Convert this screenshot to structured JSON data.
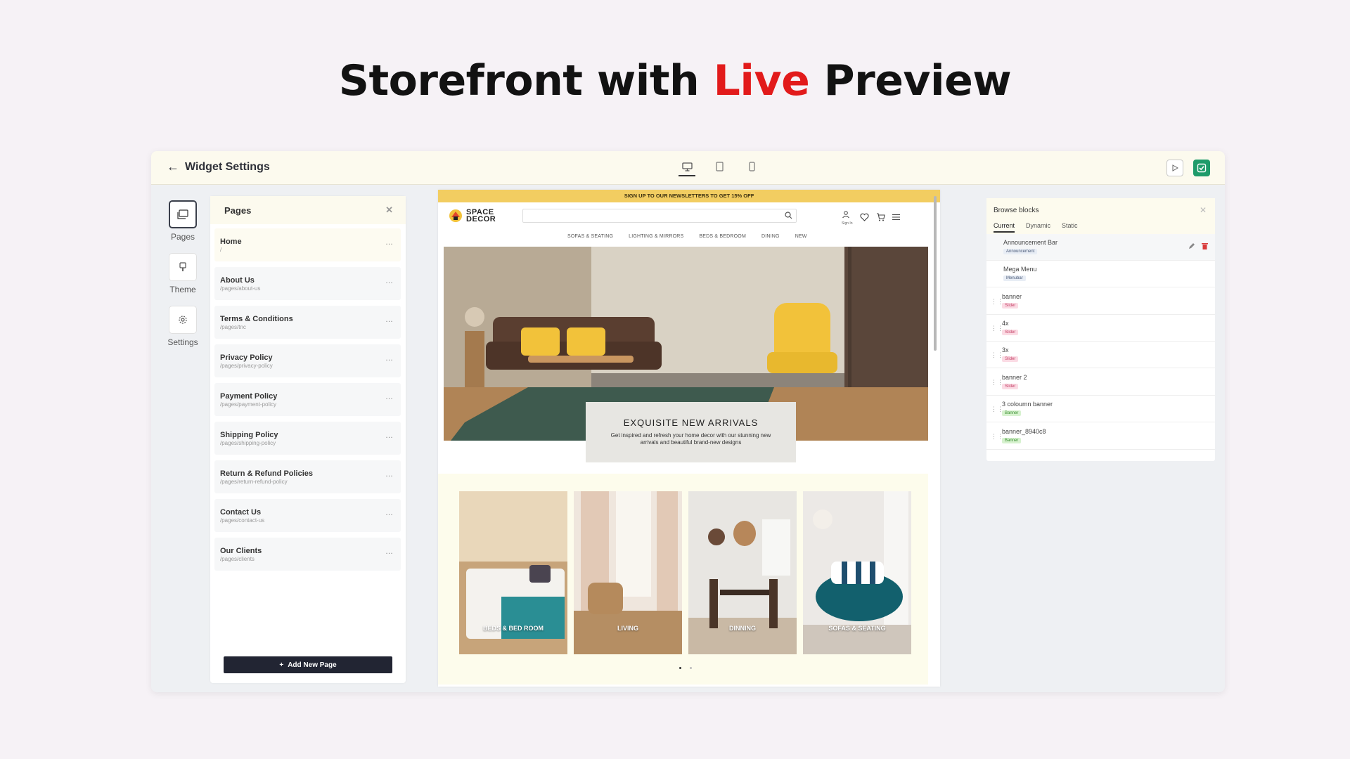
{
  "headline": {
    "part1": "Storefront with ",
    "accent": "Live",
    "part2": " Preview",
    "accent_color": "#e21b1b"
  },
  "topbar": {
    "title": "Widget Settings",
    "back_icon": "arrow-left-icon",
    "devices": [
      "desktop-icon",
      "tablet-icon",
      "mobile-icon"
    ],
    "active_device": "desktop",
    "play_icon": "play-icon",
    "save_icon": "check-icon",
    "save_color": "#1e9b6a"
  },
  "rail": {
    "items": [
      {
        "label": "Pages"
      },
      {
        "label": "Theme"
      },
      {
        "label": "Settings"
      }
    ]
  },
  "pages_panel": {
    "title": "Pages",
    "items": [
      {
        "name": "Home",
        "path": "/"
      },
      {
        "name": "About Us",
        "path": "/pages/about-us"
      },
      {
        "name": "Terms & Conditions",
        "path": "/pages/tnc"
      },
      {
        "name": "Privacy Policy",
        "path": "/pages/privacy-policy"
      },
      {
        "name": "Payment Policy",
        "path": "/pages/payment-policy"
      },
      {
        "name": "Shipping Policy",
        "path": "/pages/shipping-policy"
      },
      {
        "name": "Return & Refund Policies",
        "path": "/pages/return-refund-policy"
      },
      {
        "name": "Contact Us",
        "path": "/pages/contact-us"
      },
      {
        "name": "Our Clients",
        "path": "/pages/clients"
      }
    ],
    "more": "…",
    "add_button": "Add New Page",
    "add_icon": "+"
  },
  "preview": {
    "announcement": "SIGN UP TO OUR NEWSLETTERS TO GET 15% OFF",
    "logo_line1": "SPACE",
    "logo_line2": "DECOR",
    "signin": "Sign In",
    "nav": [
      "SOFAS & SEATING",
      "LIGHTING & MIRRORS",
      "BEDS & BEDROOM",
      "DINING",
      "NEW"
    ],
    "hero_title": "EXQUISITE NEW ARRIVALS",
    "hero_sub": "Get inspired and refresh your home decor with our stunning new arrivals and beautiful brand-new designs",
    "categories": [
      "BEDS & BED ROOM",
      "LIVING",
      "DINNING",
      "SOFAS & SEATING"
    ]
  },
  "blocks": {
    "title": "Browse blocks",
    "tabs": [
      "Current",
      "Dynamic",
      "Static"
    ],
    "active_tab": "Current",
    "items": [
      {
        "name": "Announcement Bar",
        "tag": "Announcement",
        "tag_color": "blue"
      },
      {
        "name": "Mega Menu",
        "tag": "Menubar",
        "tag_color": "blue"
      },
      {
        "name": "banner",
        "tag": "Slider",
        "tag_color": "pink"
      },
      {
        "name": "4x",
        "tag": "Slider",
        "tag_color": "pink"
      },
      {
        "name": "3x",
        "tag": "Slider",
        "tag_color": "pink"
      },
      {
        "name": "banner 2",
        "tag": "Slider",
        "tag_color": "pink"
      },
      {
        "name": "3 coloumn banner",
        "tag": "Banner",
        "tag_color": "green"
      },
      {
        "name": "banner_8940c8",
        "tag": "Banner",
        "tag_color": "green"
      }
    ]
  }
}
